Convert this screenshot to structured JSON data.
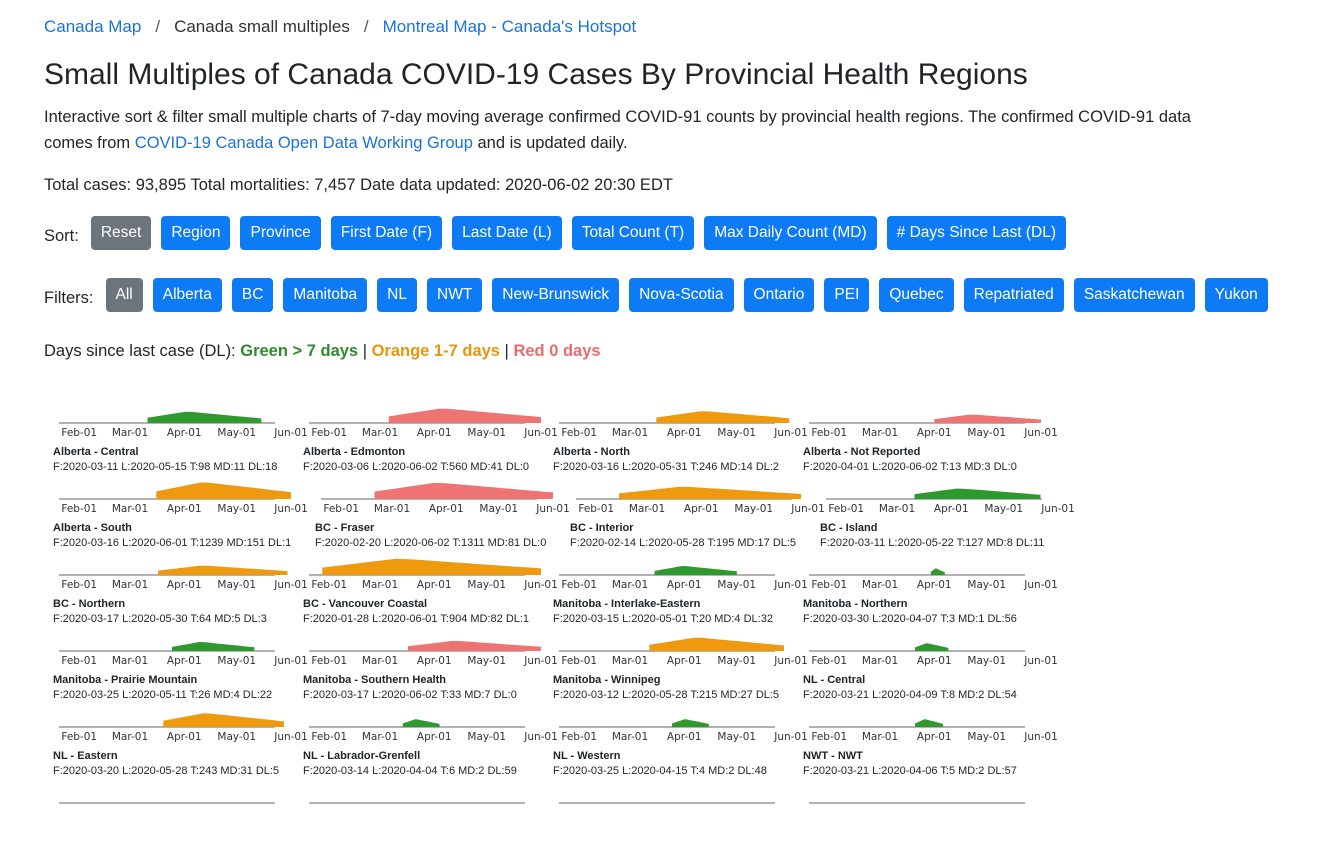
{
  "breadcrumb": {
    "link1": "Canada Map",
    "separator": "/",
    "current": "Canada small multiples",
    "link2": "Montreal Map - Canada's Hotspot"
  },
  "page": {
    "title": "Small Multiples of Canada COVID-19 Cases By Provincial Health Regions",
    "desc_before": "Interactive sort & filter small multiple charts of 7-day moving average confirmed COVID-91 counts by provincial health regions. The confirmed COVID-91 data comes from ",
    "desc_link": "COVID-19 Canada Open Data Working Group",
    "desc_after": " and is updated daily.",
    "totals": "Total cases: 93,895 Total mortalities: 7,457 Date data updated: 2020-06-02 20:30 EDT"
  },
  "sort": {
    "label": "Sort:",
    "buttons": [
      "Reset",
      "Region",
      "Province",
      "First Date (F)",
      "Last Date (L)",
      "Total Count (T)",
      "Max Daily Count (MD)",
      "# Days Since Last (DL)"
    ]
  },
  "filters": {
    "label": "Filters:",
    "buttons": [
      "All",
      "Alberta",
      "BC",
      "Manitoba",
      "NL",
      "NWT",
      "New-Brunswick",
      "Nova-Scotia",
      "Ontario",
      "PEI",
      "Quebec",
      "Repatriated",
      "Saskatchewan",
      "Yukon"
    ]
  },
  "legend": {
    "prefix": "Days since last case (DL): ",
    "green": "Green > 7 days",
    "sep": " | ",
    "orange": "Orange 1-7 days",
    "red": "Red 0 days"
  },
  "colors": {
    "green": "#2e9a2e",
    "orange": "#ef9a0e",
    "red": "#f07373",
    "button_blue": "#0d7bf5",
    "button_gray": "#6c757d",
    "link": "#1a73d9"
  },
  "ticks": [
    "Feb-01",
    "Mar-01",
    "Apr-01",
    "May-01",
    "Jun-01"
  ],
  "charts": [
    {
      "region": "Alberta - Central",
      "first": "2020-03-11",
      "last": "2020-05-15",
      "total": 98,
      "max_daily": 11,
      "days_since_last": 18,
      "stats": "F:2020-03-11 L:2020-05-15 T:98 MD:11 DL:18",
      "color": "green"
    },
    {
      "region": "Alberta - Edmonton",
      "first": "2020-03-06",
      "last": "2020-06-02",
      "total": 560,
      "max_daily": 41,
      "days_since_last": 0,
      "stats": "F:2020-03-06 L:2020-06-02 T:560 MD:41 DL:0",
      "color": "red"
    },
    {
      "region": "Alberta - North",
      "first": "2020-03-16",
      "last": "2020-05-31",
      "total": 246,
      "max_daily": 14,
      "days_since_last": 2,
      "stats": "F:2020-03-16 L:2020-05-31 T:246 MD:14 DL:2",
      "color": "orange"
    },
    {
      "region": "Alberta - Not Reported",
      "first": "2020-04-01",
      "last": "2020-06-02",
      "total": 13,
      "max_daily": 3,
      "days_since_last": 0,
      "stats": "F:2020-04-01 L:2020-06-02 T:13 MD:3 DL:0",
      "color": "red"
    },
    {
      "region": "Alberta - South",
      "first": "2020-03-16",
      "last": "2020-06-01",
      "total": 1239,
      "max_daily": 151,
      "days_since_last": 1,
      "stats": "F:2020-03-16 L:2020-06-01 T:1239 MD:151 DL:1",
      "color": "orange"
    },
    {
      "region": "BC - Fraser",
      "first": "2020-02-20",
      "last": "2020-06-02",
      "total": 1311,
      "max_daily": 81,
      "days_since_last": 0,
      "stats": "F:2020-02-20 L:2020-06-02 T:1311 MD:81 DL:0",
      "color": "red"
    },
    {
      "region": "BC - Interior",
      "first": "2020-02-14",
      "last": "2020-05-28",
      "total": 195,
      "max_daily": 17,
      "days_since_last": 5,
      "stats": "F:2020-02-14 L:2020-05-28 T:195 MD:17 DL:5",
      "color": "orange"
    },
    {
      "region": "BC - Island",
      "first": "2020-03-11",
      "last": "2020-05-22",
      "total": 127,
      "max_daily": 8,
      "days_since_last": 11,
      "stats": "F:2020-03-11 L:2020-05-22 T:127 MD:8 DL:11",
      "color": "green"
    },
    {
      "region": "BC - Northern",
      "first": "2020-03-17",
      "last": "2020-05-30",
      "total": 64,
      "max_daily": 5,
      "days_since_last": 3,
      "stats": "F:2020-03-17 L:2020-05-30 T:64 MD:5 DL:3",
      "color": "orange"
    },
    {
      "region": "BC - Vancouver Coastal",
      "first": "2020-01-28",
      "last": "2020-06-01",
      "total": 904,
      "max_daily": 82,
      "days_since_last": 1,
      "stats": "F:2020-01-28 L:2020-06-01 T:904 MD:82 DL:1",
      "color": "orange"
    },
    {
      "region": "Manitoba - Interlake-Eastern",
      "first": "2020-03-15",
      "last": "2020-05-01",
      "total": 20,
      "max_daily": 4,
      "days_since_last": 32,
      "stats": "F:2020-03-15 L:2020-05-01 T:20 MD:4 DL:32",
      "color": "green"
    },
    {
      "region": "Manitoba - Northern",
      "first": "2020-03-30",
      "last": "2020-04-07",
      "total": 3,
      "max_daily": 1,
      "days_since_last": 56,
      "stats": "F:2020-03-30 L:2020-04-07 T:3 MD:1 DL:56",
      "color": "green"
    },
    {
      "region": "Manitoba - Prairie Mountain",
      "first": "2020-03-25",
      "last": "2020-05-11",
      "total": 26,
      "max_daily": 4,
      "days_since_last": 22,
      "stats": "F:2020-03-25 L:2020-05-11 T:26 MD:4 DL:22",
      "color": "green"
    },
    {
      "region": "Manitoba - Southern Health",
      "first": "2020-03-17",
      "last": "2020-06-02",
      "total": 33,
      "max_daily": 7,
      "days_since_last": 0,
      "stats": "F:2020-03-17 L:2020-06-02 T:33 MD:7 DL:0",
      "color": "red"
    },
    {
      "region": "Manitoba - Winnipeg",
      "first": "2020-03-12",
      "last": "2020-05-28",
      "total": 215,
      "max_daily": 27,
      "days_since_last": 5,
      "stats": "F:2020-03-12 L:2020-05-28 T:215 MD:27 DL:5",
      "color": "orange"
    },
    {
      "region": "NL - Central",
      "first": "2020-03-21",
      "last": "2020-04-09",
      "total": 8,
      "max_daily": 2,
      "days_since_last": 54,
      "stats": "F:2020-03-21 L:2020-04-09 T:8 MD:2 DL:54",
      "color": "green"
    },
    {
      "region": "NL - Eastern",
      "first": "2020-03-20",
      "last": "2020-05-28",
      "total": 243,
      "max_daily": 31,
      "days_since_last": 5,
      "stats": "F:2020-03-20 L:2020-05-28 T:243 MD:31 DL:5",
      "color": "orange"
    },
    {
      "region": "NL - Labrador-Grenfell",
      "first": "2020-03-14",
      "last": "2020-04-04",
      "total": 6,
      "max_daily": 2,
      "days_since_last": 59,
      "stats": "F:2020-03-14 L:2020-04-04 T:6 MD:2 DL:59",
      "color": "green"
    },
    {
      "region": "NL - Western",
      "first": "2020-03-25",
      "last": "2020-04-15",
      "total": 4,
      "max_daily": 2,
      "days_since_last": 48,
      "stats": "F:2020-03-25 L:2020-04-15 T:4 MD:2 DL:48",
      "color": "green"
    },
    {
      "region": "NWT - NWT",
      "first": "2020-03-21",
      "last": "2020-04-06",
      "total": 5,
      "max_daily": 2,
      "days_since_last": 57,
      "stats": "F:2020-03-21 L:2020-04-06 T:5 MD:2 DL:57",
      "color": "green"
    },
    {
      "region": "",
      "stats": "",
      "color": "green"
    },
    {
      "region": "",
      "stats": "",
      "color": "green"
    },
    {
      "region": "",
      "stats": "",
      "color": "green"
    },
    {
      "region": "",
      "stats": "",
      "color": "green"
    }
  ]
}
